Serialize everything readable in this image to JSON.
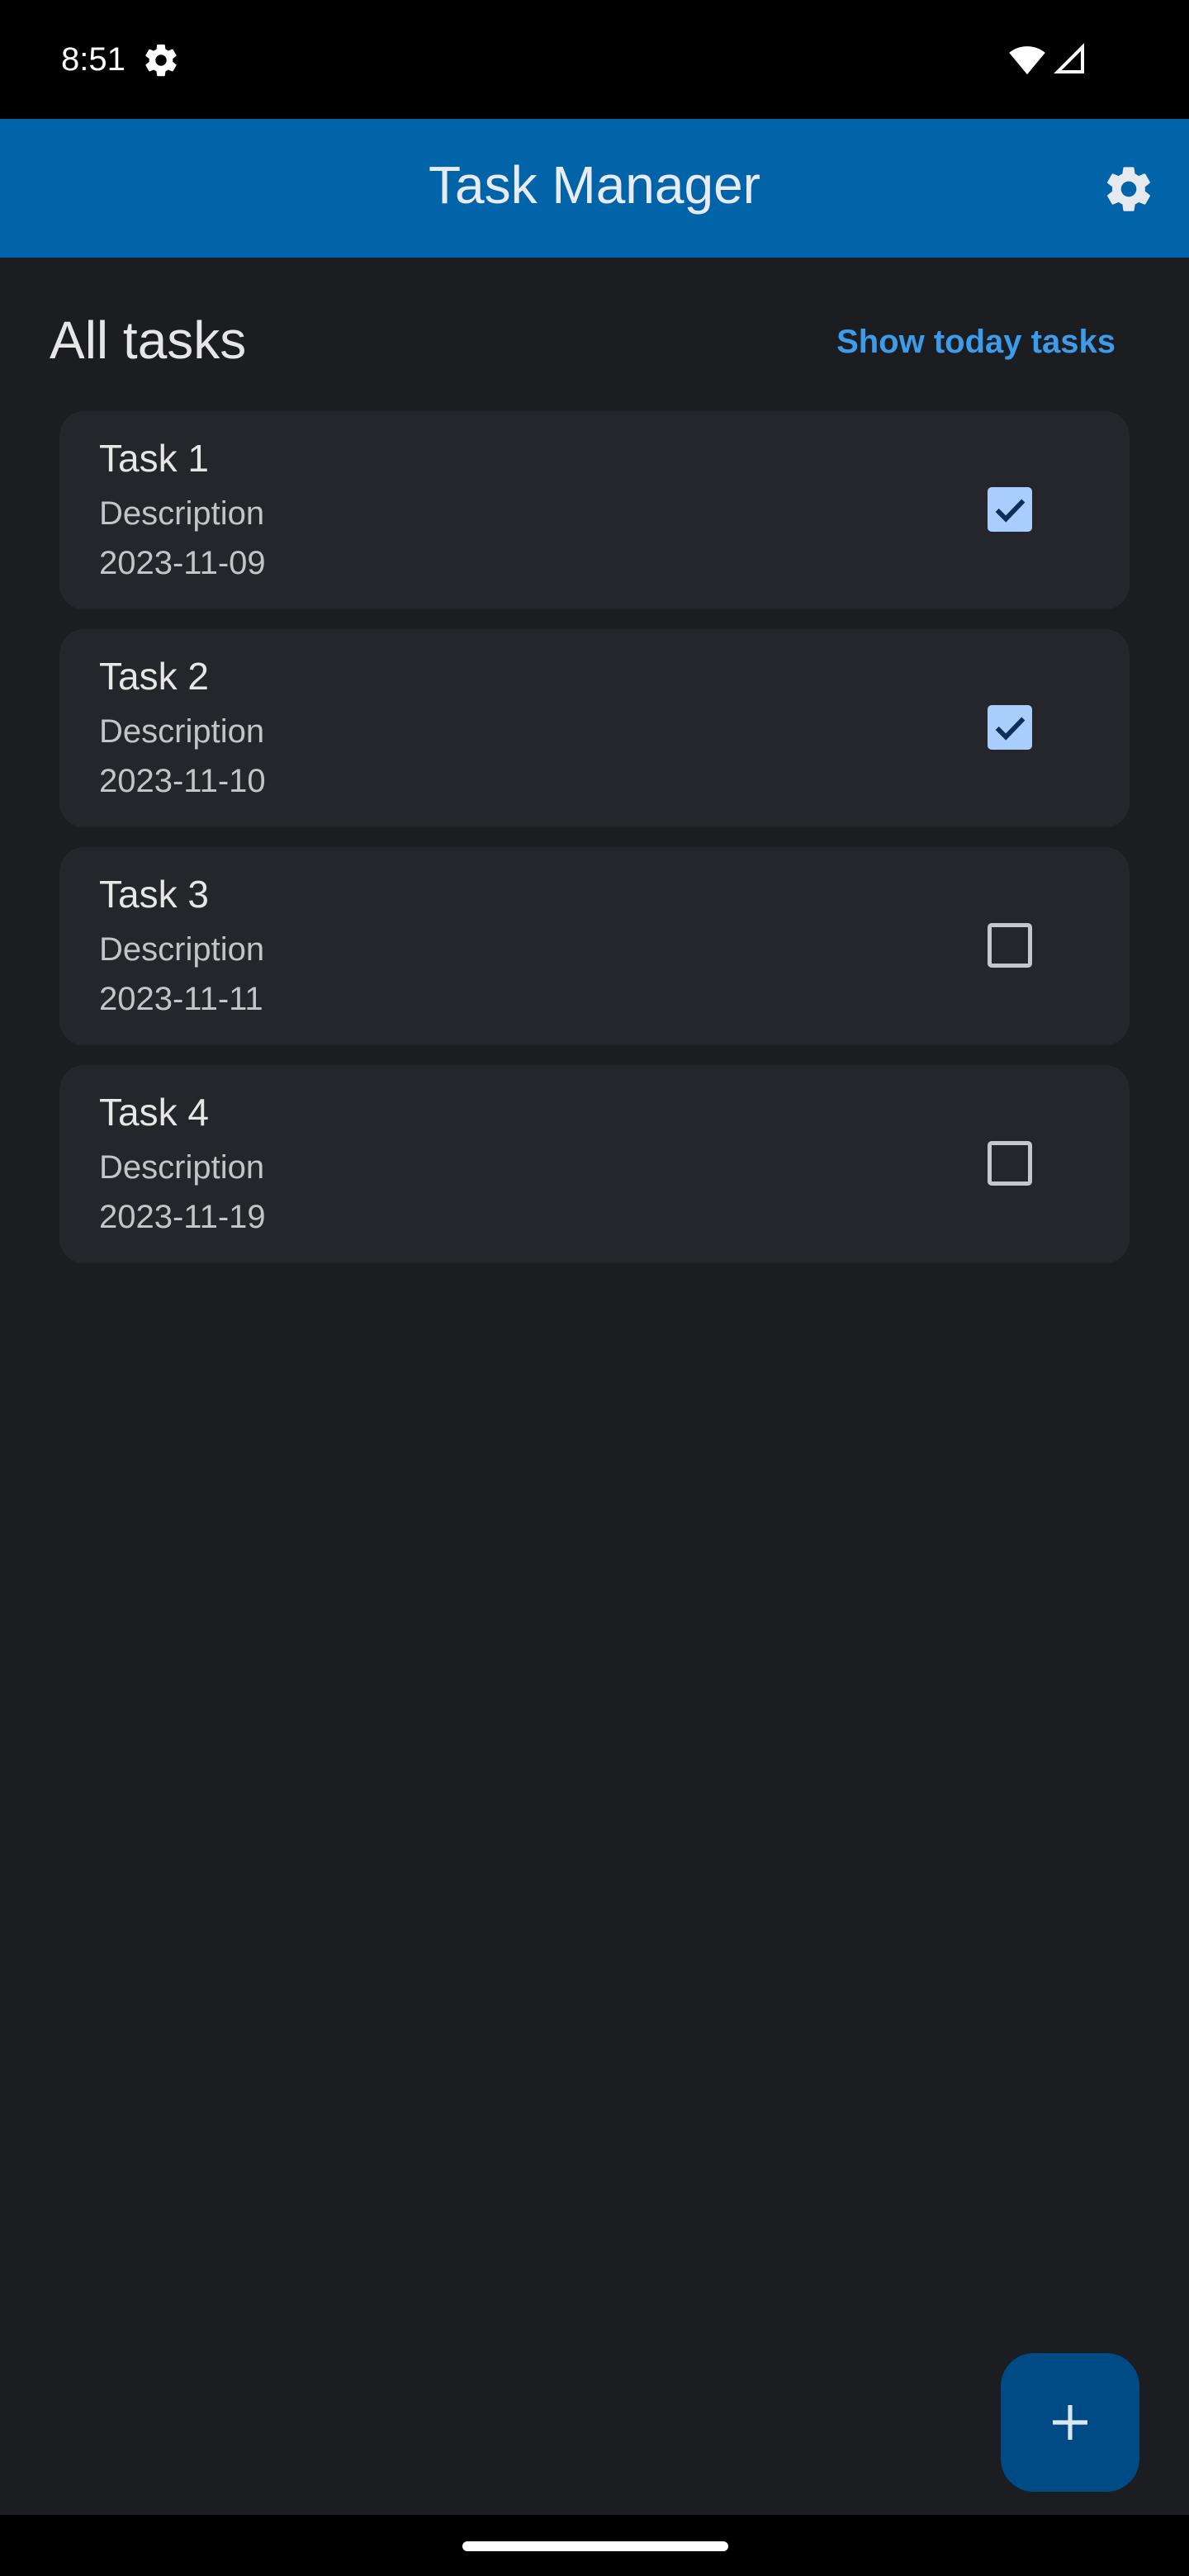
{
  "status_bar": {
    "time": "8:51",
    "icons": [
      "settings-gear-icon",
      "wifi-icon",
      "signal-icon"
    ]
  },
  "app_bar": {
    "title": "Task Manager",
    "settings_icon": "gear-icon",
    "background_color": "#0264a8"
  },
  "section": {
    "title": "All tasks",
    "link_label": "Show today tasks"
  },
  "tasks": [
    {
      "title": "Task 1",
      "description": "Description",
      "date": "2023-11-09",
      "done": true
    },
    {
      "title": "Task 2",
      "description": "Description",
      "date": "2023-11-10",
      "done": true
    },
    {
      "title": "Task 3",
      "description": "Description",
      "date": "2023-11-11",
      "done": false
    },
    {
      "title": "Task 4",
      "description": "Description",
      "date": "2023-11-19",
      "done": false
    }
  ],
  "fab": {
    "icon": "plus-icon",
    "color": "#004a86"
  },
  "colors": {
    "background": "#1c1d20",
    "card": "#24262b",
    "accent_link": "#3c9bea",
    "checkbox_checked": "#a9cdfd"
  }
}
